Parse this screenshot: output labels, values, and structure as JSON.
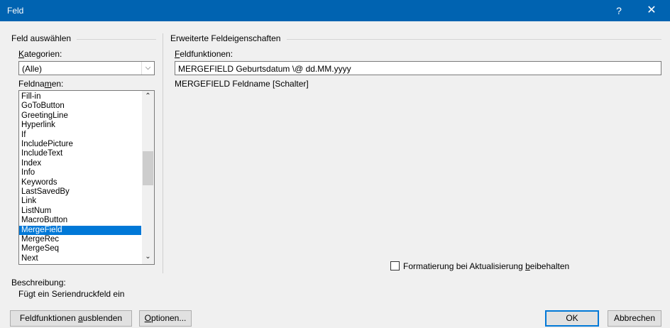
{
  "window": {
    "title": "Feld",
    "help_label": "?",
    "close_label": "✕"
  },
  "left": {
    "section_title": "Feld auswählen",
    "categories_label": {
      "before": "",
      "ul": "K",
      "after": "ategorien:"
    },
    "category_value": "(Alle)",
    "fieldnames_label": {
      "before": "Feldna",
      "ul": "m",
      "after": "en:"
    },
    "field_names": [
      "Fill-in",
      "GoToButton",
      "GreetingLine",
      "Hyperlink",
      "If",
      "IncludePicture",
      "IncludeText",
      "Index",
      "Info",
      "Keywords",
      "LastSavedBy",
      "Link",
      "ListNum",
      "MacroButton",
      "MergeField",
      "MergeRec",
      "MergeSeq",
      "Next"
    ],
    "selected_field": "MergeField",
    "description_label": "Beschreibung:",
    "description_text": "Fügt ein Seriendruckfeld ein"
  },
  "right": {
    "section_title": "Erweiterte Feldeigenschaften",
    "codes_label": {
      "before": "",
      "ul": "F",
      "after": "eldfunktionen:"
    },
    "code_value": "MERGEFIELD  Geburtsdatum \\@ dd.MM.yyyy",
    "syntax_hint": "MERGEFIELD Feldname [Schalter]",
    "preserve_label": {
      "before": "Formatierung bei Aktualisierung ",
      "ul": "b",
      "after": "eibehalten"
    },
    "preserve_checked": false
  },
  "buttons": {
    "hide_codes": {
      "before": "Feldfunktionen ",
      "ul": "a",
      "after": "usblenden"
    },
    "options": {
      "before": "",
      "ul": "O",
      "after": "ptionen..."
    },
    "ok": "OK",
    "cancel": "Abbrechen"
  },
  "colors": {
    "titlebar": "#0063b1",
    "selection": "#0078d7"
  },
  "icons": {
    "combo_arrow": "chevron-down-icon",
    "scroll_up": "chevron-up-icon",
    "scroll_down": "chevron-down-icon",
    "close": "close-icon",
    "help": "help-icon"
  }
}
